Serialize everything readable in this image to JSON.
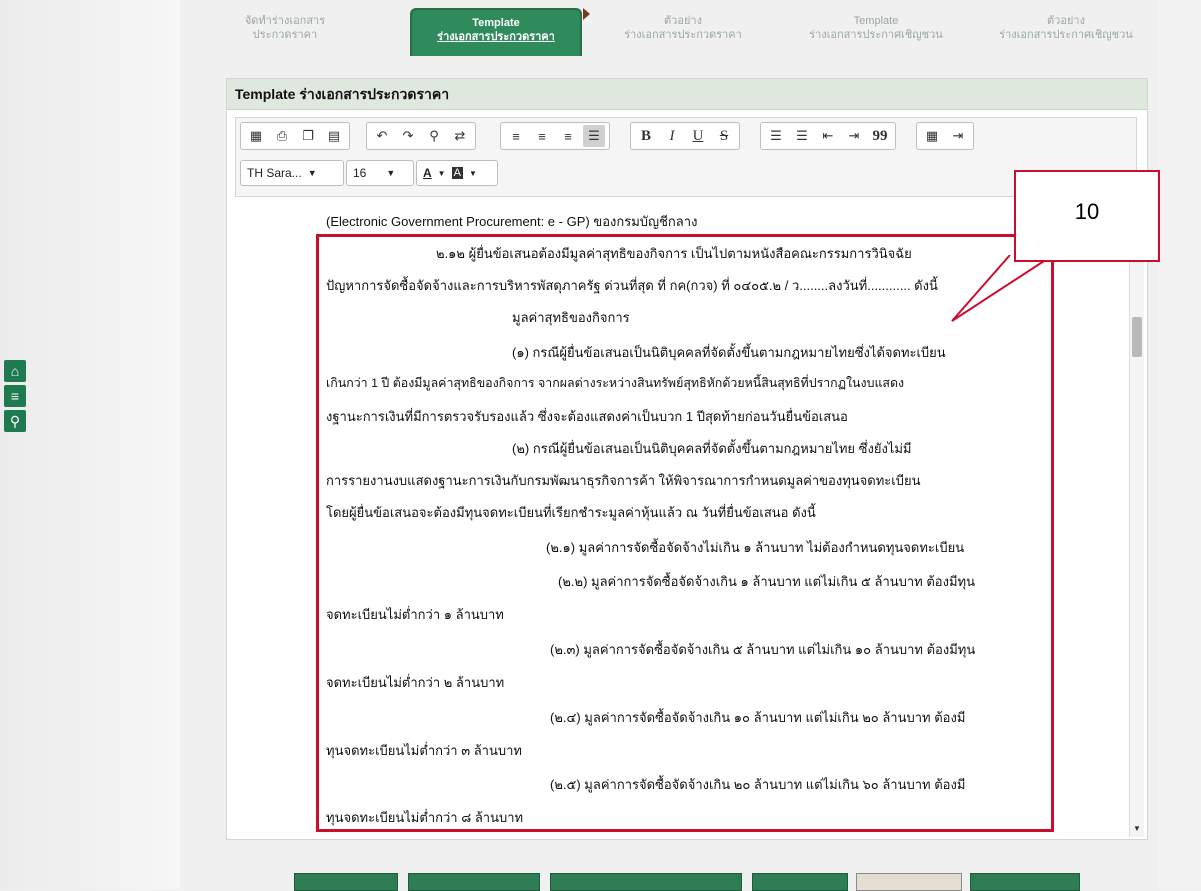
{
  "steps": [
    {
      "line1": "จัดทำร่างเอกสาร",
      "line2": "ประกวดราคา",
      "active": false
    },
    {
      "line1": "Template",
      "line2": "ร่างเอกสารประกวดราคา",
      "active": true
    },
    {
      "line1": "ตัวอย่าง",
      "line2": "ร่างเอกสารประกวดราคา",
      "active": false
    },
    {
      "line1": "Template",
      "line2": "ร่างเอกสารประกาศเชิญชวน",
      "active": false
    },
    {
      "line1": "ตัวอย่าง",
      "line2": "ร่างเอกสารประกาศเชิญชวน",
      "active": false
    }
  ],
  "panel": {
    "title": "Template ร่างเอกสารประกวดราคา"
  },
  "toolbar": {
    "font_name": "TH Sara...",
    "font_size": "16",
    "bold": "B",
    "italic": "I",
    "underline": "U",
    "strike": "S",
    "quote": "99"
  },
  "document": {
    "lines": [
      "(Electronic Government Procurement: e - GP) ของกรมบัญชีกลาง",
      "๒.๑๒   ผู้ยื่นข้อเสนอต้องมีมูลค่าสุทธิของกิจการ เป็นไปตามหนังสือคณะกรรมการวินิจฉัย",
      "ปัญหาการจัดซื้อจัดจ้างและการบริหารพัสดุภาครัฐ ด่วนที่สุด ที่ กค(กวจ) ที่ ๐๔๐๕.๒ / ว........ลงวันที่............ ดังนี้",
      "มูลค่าสุทธิของกิจการ",
      "(๑) กรณีผู้ยื่นข้อเสนอเป็นนิติบุคคลที่จัดตั้งขึ้นตามกฎหมายไทยซึ่งได้จดทะเบียน",
      "เกินกว่า 1 ปี ต้องมีมูลค่าสุทธิของกิจการ จากผลต่างระหว่างสินทรัพย์สุทธิหักด้วยหนี้สินสุทธิที่ปรากฏในงบแสดง",
      "งฐานะการเงินที่มีการตรวจรับรองแล้ว ซึ่งจะต้องแสดงค่าเป็นบวก 1 ปีสุดท้ายก่อนวันยื่นข้อเสนอ",
      "(๒) กรณีผู้ยื่นข้อเสนอเป็นนิติบุคคลที่จัดตั้งขึ้นตามกฎหมายไทย ซึ่งยังไม่มี",
      "การรายงานงบแสดงฐานะการเงินกับกรมพัฒนาธุรกิจการค้า ให้พิจารณาการกำหนดมูลค่าของทุนจดทะเบียน",
      "โดยผู้ยื่นข้อเสนอจะต้องมีทุนจดทะเบียนที่เรียกชำระมูลค่าหุ้นแล้ว ณ วันที่ยื่นข้อเสนอ ดังนี้",
      "(๒.๑)  มูลค่าการจัดซื้อจัดจ้างไม่เกิน ๑ ล้านบาท ไม่ต้องกำหนดทุนจดทะเบียน",
      "(๒.๒)  มูลค่าการจัดซื้อจัดจ้างเกิน ๑ ล้านบาท แต่ไม่เกิน ๕ ล้านบาท ต้องมีทุน",
      "จดทะเบียนไม่ต่ำกว่า ๑ ล้านบาท",
      "(๒.๓)  มูลค่าการจัดซื้อจัดจ้างเกิน ๕ ล้านบาท แต่ไม่เกิน ๑๐ ล้านบาท ต้องมีทุน",
      "จดทะเบียนไม่ต่ำกว่า ๒ ล้านบาท",
      "(๒.๔)  มูลค่าการจัดซื้อจัดจ้างเกิน ๑๐ ล้านบาท แต่ไม่เกิน ๒๐ ล้านบาท ต้องมี",
      "ทุนจดทะเบียนไม่ต่ำกว่า ๓ ล้านบาท",
      "(๒.๕)  มูลค่าการจัดซื้อจัดจ้างเกิน ๒๐ ล้านบาท แต่ไม่เกิน ๖๐ ล้านบาท ต้องมี",
      "ทุนจดทะเบียนไม่ต่ำกว่า ๘ ล้านบาท"
    ]
  },
  "annotation": {
    "callout_number": "10"
  },
  "colors": {
    "accent_green": "#2f8a5c",
    "annotation_red": "#c8102e"
  },
  "bottom_buttons": [
    "",
    "",
    "",
    "",
    "",
    ""
  ]
}
